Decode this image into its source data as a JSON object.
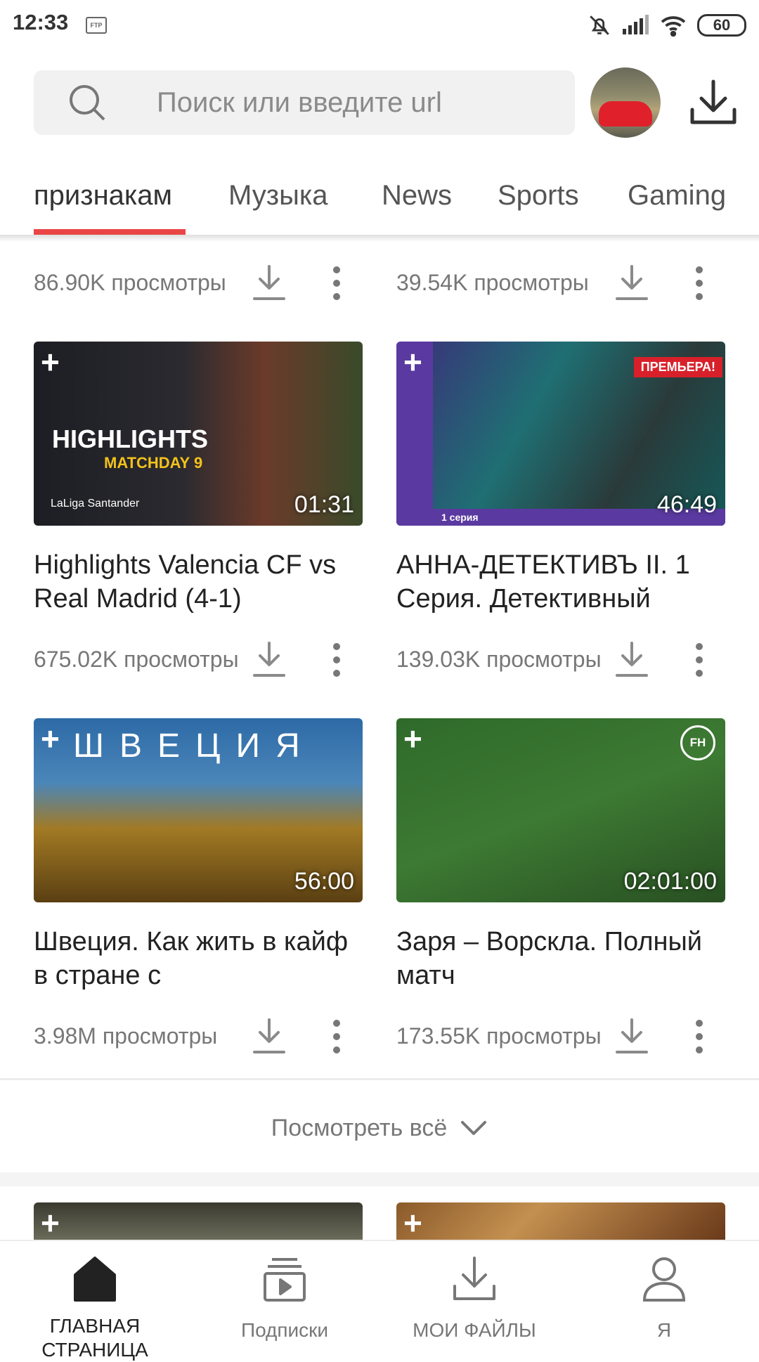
{
  "status_bar": {
    "time": "12:33",
    "ftp": "FTP",
    "battery": "60"
  },
  "search": {
    "placeholder": "Поиск или введите url"
  },
  "tabs": [
    {
      "label": "признакам"
    },
    {
      "label": "Музыка"
    },
    {
      "label": "News"
    },
    {
      "label": "Sports"
    },
    {
      "label": "Gaming"
    }
  ],
  "top_row": [
    {
      "views": "86.90K просмотры"
    },
    {
      "views": "39.54K просмотры"
    }
  ],
  "videos": [
    {
      "title": "Highlights Valencia CF vs Real Madrid (4-1)",
      "views": "675.02K просмотры",
      "duration": "01:31",
      "thumb_text": {
        "headline": "HIGHLIGHTS",
        "sub": "MATCHDAY 9",
        "logo": "LaLiga Santander"
      }
    },
    {
      "title": "АННА-ДЕТЕКТИВЪ II. 1 Серия. Детективный",
      "views": "139.03K просмотры",
      "duration": "46:49",
      "thumb_text": {
        "badge": "ПРЕМЬЕРА!",
        "series": "1 серия"
      }
    },
    {
      "title": "Швеция. Как жить в кайф в стране с",
      "views": "3.98M просмотры",
      "duration": "56:00",
      "thumb_text": {
        "overlay": "ШВЕЦИЯ"
      }
    },
    {
      "title": "Заря – Ворскла. Полный матч",
      "views": "173.55K просмотры",
      "duration": "02:01:00",
      "thumb_text": {
        "badge": "FH"
      }
    }
  ],
  "see_all": "Посмотреть всё",
  "plus": "+",
  "bottom_nav": [
    {
      "label": "ГЛАВНАЯ СТРАНИЦА",
      "icon": "home-icon"
    },
    {
      "label": "Подписки",
      "icon": "subscriptions-icon"
    },
    {
      "label": "МОИ ФАЙЛЫ",
      "icon": "my-files-icon"
    },
    {
      "label": "Я",
      "icon": "profile-icon"
    }
  ],
  "colors": {
    "accent": "#e94545",
    "text": "#222222",
    "secondary": "#777777"
  }
}
